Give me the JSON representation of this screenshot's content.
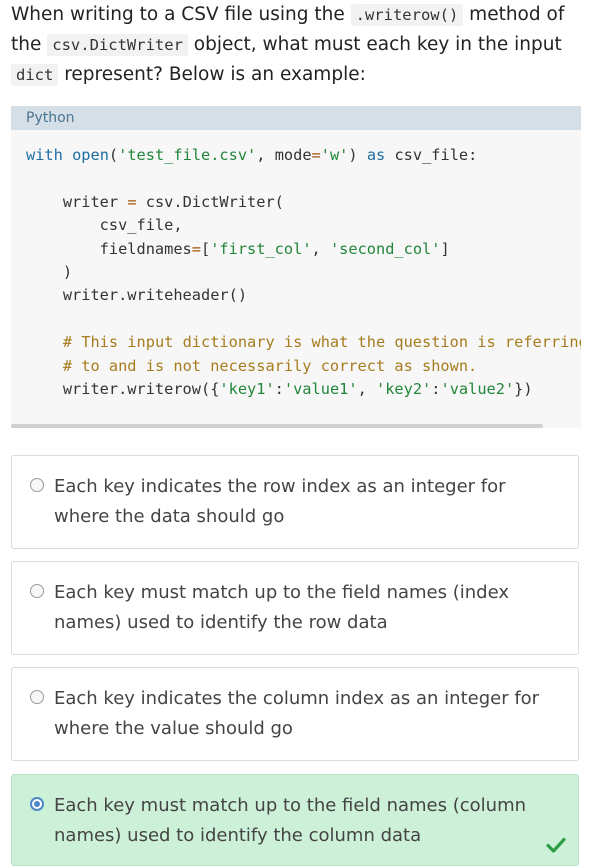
{
  "question": {
    "part1": "When writing to a CSV file using the ",
    "code1": ".writerow()",
    "part2": " method of the ",
    "code2": "csv.DictWriter",
    "part3": " object, what must each key in the input ",
    "code3": "dict",
    "part4": " represent? Below is an example:"
  },
  "code": {
    "language": "Python"
  },
  "options": [
    {
      "text": "Each key indicates the row index as an integer for where the data should go",
      "selected": false,
      "correct": false
    },
    {
      "text": "Each key must match up to the field names (index names) used to identify the row data",
      "selected": false,
      "correct": false
    },
    {
      "text": "Each key indicates the column index as an integer for where the value should go",
      "selected": false,
      "correct": false
    },
    {
      "text": "Each key must match up to the field names (column names) used to identify the column data",
      "selected": true,
      "correct": true
    }
  ],
  "colors": {
    "correct_bg": "#cdf0d8",
    "check": "#2e9e45",
    "radio_selected": "#4a88c8",
    "code_header_bg": "#d4dfe7"
  },
  "icons": {
    "correct": "checkmark-icon"
  }
}
